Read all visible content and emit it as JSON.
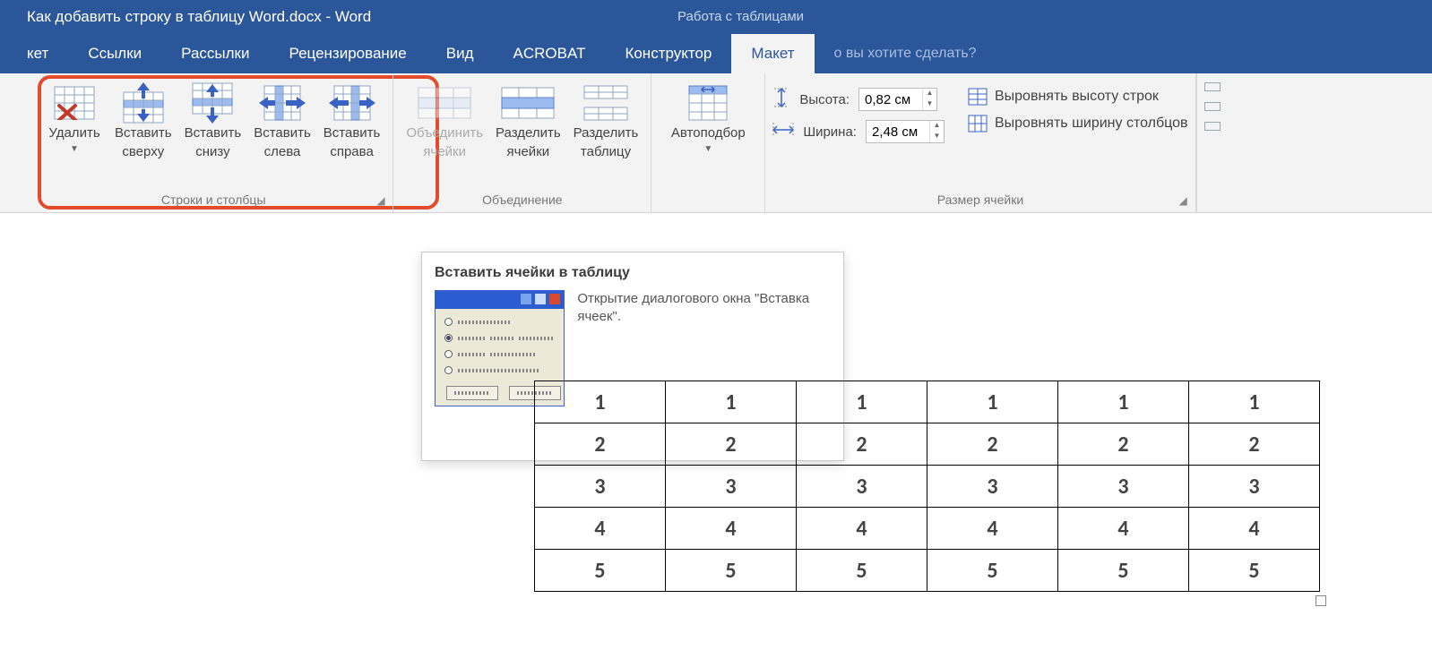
{
  "title": "Как добавить строку в таблицу Word.docx - Word",
  "contextual": "Работа с таблицами",
  "tabs": {
    "partial": "кет",
    "links": "Ссылки",
    "mailings": "Рассылки",
    "review": "Рецензирование",
    "view": "Вид",
    "acrobat": "ACROBAT",
    "design": "Конструктор",
    "layout": "Макет"
  },
  "tellme": "о вы хотите сделать?",
  "groups": {
    "rc": {
      "label": "Строки и столбцы",
      "delete": "Удалить",
      "insert_above1": "Вставить",
      "insert_above2": "сверху",
      "insert_below1": "Вставить",
      "insert_below2": "снизу",
      "insert_left1": "Вставить",
      "insert_left2": "слева",
      "insert_right1": "Вставить",
      "insert_right2": "справа"
    },
    "merge": {
      "label": "Объединение",
      "merge1": "Объединить",
      "merge2": "ячейки",
      "split1": "Разделить",
      "split2": "ячейки",
      "splitt1": "Разделить",
      "splitt2": "таблицу"
    },
    "autofit": "Автоподбор",
    "size": {
      "label": "Размер ячейки",
      "height": "Высота:",
      "height_val": "0,82 см",
      "width": "Ширина:",
      "width_val": "2,48 см",
      "dist_rows": "Выровнять высоту строк",
      "dist_cols": "Выровнять ширину столбцов"
    }
  },
  "tooltip": {
    "title": "Вставить ячейки в таблицу",
    "desc": "Открытие диалогового окна \"Вставка ячеек\"."
  },
  "table": {
    "rows": [
      [
        "1",
        "1",
        "1",
        "1",
        "1",
        "1"
      ],
      [
        "2",
        "2",
        "2",
        "2",
        "2",
        "2"
      ],
      [
        "3",
        "3",
        "3",
        "3",
        "3",
        "3"
      ],
      [
        "4",
        "4",
        "4",
        "4",
        "4",
        "4"
      ],
      [
        "5",
        "5",
        "5",
        "5",
        "5",
        "5"
      ]
    ]
  }
}
